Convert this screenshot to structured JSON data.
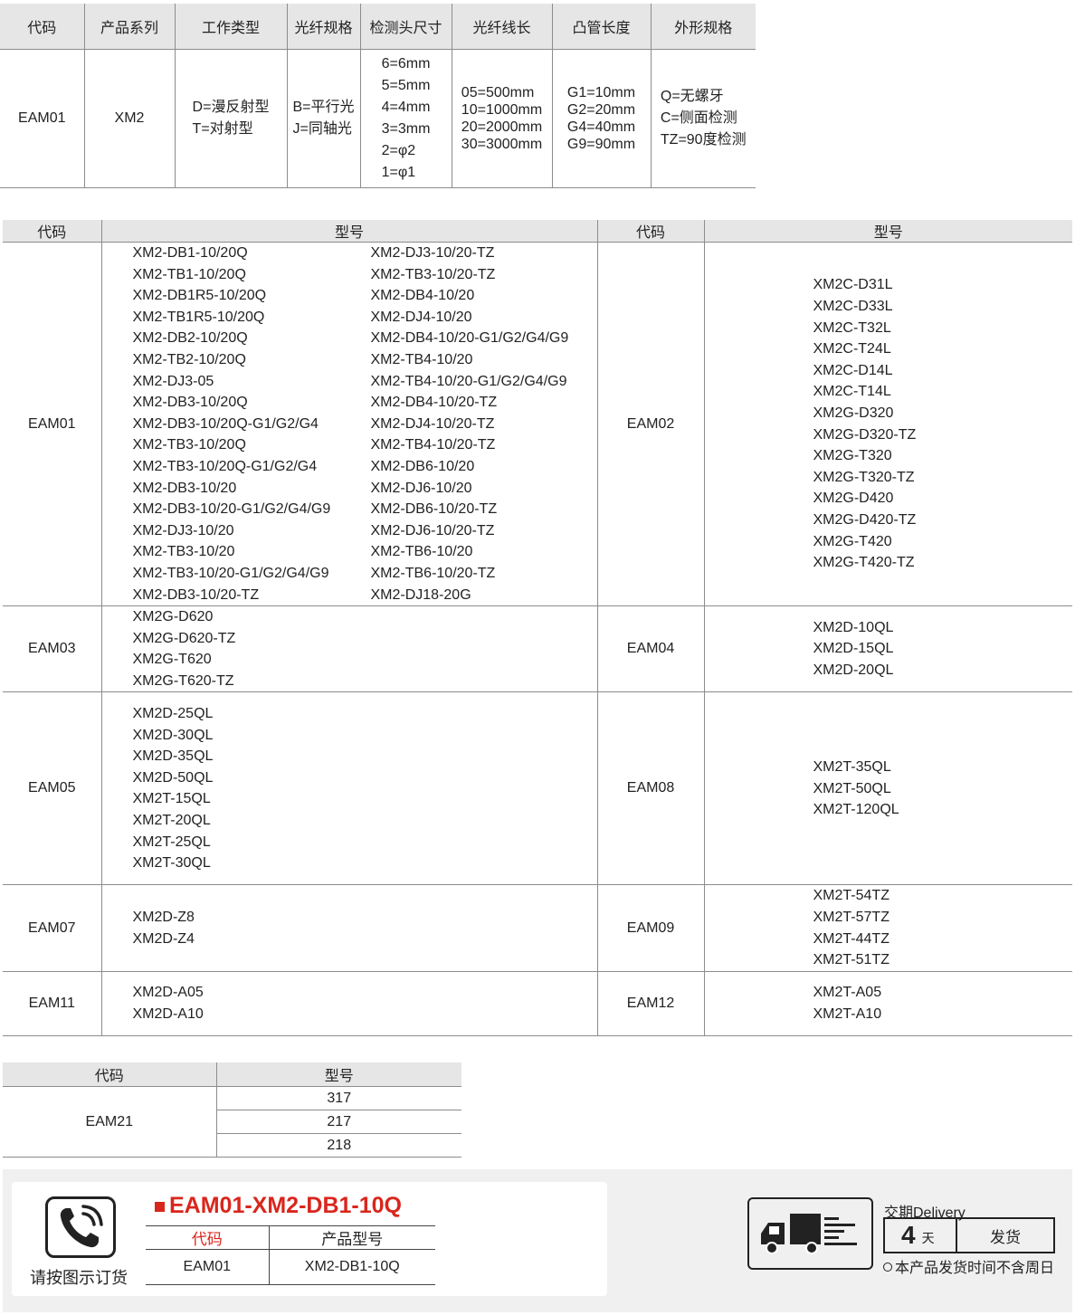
{
  "spec_table": {
    "headers": [
      "代码",
      "产品系列",
      "工作类型",
      "光纤规格",
      "检测头尺寸",
      "光纤线长",
      "凸管长度",
      "外形规格"
    ],
    "code": "EAM01",
    "series": "XM2",
    "work_type": [
      "D=漫反射型",
      "T=对射型"
    ],
    "fiber_spec": [
      "B=平行光",
      "J=同轴光"
    ],
    "head_size": [
      "6=6mm",
      "5=5mm",
      "4=4mm",
      "3=3mm",
      "2=φ2",
      "1=φ1"
    ],
    "fiber_length": [
      "05=500mm",
      "10=1000mm",
      "20=2000mm",
      "30=3000mm"
    ],
    "tube_length": [
      "G1=10mm",
      "G2=20mm",
      "G4=40mm",
      "G9=90mm"
    ],
    "shape": [
      "Q=无螺牙",
      "C=侧面检测",
      "TZ=90度检测"
    ]
  },
  "model_table": {
    "headers": [
      "代码",
      "型号",
      "代码",
      "型号"
    ],
    "eam01": {
      "code": "EAM01",
      "col1": [
        "XM2-DB1-10/20Q",
        "XM2-TB1-10/20Q",
        "XM2-DB1R5-10/20Q",
        "XM2-TB1R5-10/20Q",
        "XM2-DB2-10/20Q",
        "XM2-TB2-10/20Q",
        "XM2-DJ3-05",
        "XM2-DB3-10/20Q",
        "XM2-DB3-10/20Q-G1/G2/G4",
        "XM2-TB3-10/20Q",
        "XM2-TB3-10/20Q-G1/G2/G4",
        "XM2-DB3-10/20",
        "XM2-DB3-10/20-G1/G2/G4/G9",
        "XM2-DJ3-10/20",
        "XM2-TB3-10/20",
        "XM2-TB3-10/20-G1/G2/G4/G9",
        "XM2-DB3-10/20-TZ"
      ],
      "col2": [
        "XM2-DJ3-10/20-TZ",
        "XM2-TB3-10/20-TZ",
        "XM2-DB4-10/20",
        "XM2-DJ4-10/20",
        "XM2-DB4-10/20-G1/G2/G4/G9",
        "XM2-TB4-10/20",
        "XM2-TB4-10/20-G1/G2/G4/G9",
        "XM2-DB4-10/20-TZ",
        "XM2-DJ4-10/20-TZ",
        "XM2-TB4-10/20-TZ",
        "XM2-DB6-10/20",
        "XM2-DJ6-10/20",
        "XM2-DB6-10/20-TZ",
        "XM2-DJ6-10/20-TZ",
        "XM2-TB6-10/20",
        "XM2-TB6-10/20-TZ",
        "XM2-DJ18-20G"
      ]
    },
    "eam02": {
      "code": "EAM02",
      "items": [
        "XM2C-D31L",
        "XM2C-D33L",
        "XM2C-T32L",
        "XM2C-T24L",
        "XM2C-D14L",
        "XM2C-T14L",
        "XM2G-D320",
        "XM2G-D320-TZ",
        "XM2G-T320",
        "XM2G-T320-TZ",
        "XM2G-D420",
        "XM2G-D420-TZ",
        "XM2G-T420",
        "XM2G-T420-TZ"
      ]
    },
    "eam03": {
      "code": "EAM03",
      "items": [
        "XM2G-D620",
        "XM2G-D620-TZ",
        "XM2G-T620",
        "XM2G-T620-TZ"
      ]
    },
    "eam04": {
      "code": "EAM04",
      "items": [
        "XM2D-10QL",
        "XM2D-15QL",
        "XM2D-20QL"
      ]
    },
    "eam05": {
      "code": "EAM05",
      "items": [
        "XM2D-25QL",
        "XM2D-30QL",
        "XM2D-35QL",
        "XM2D-50QL",
        "XM2T-15QL",
        "XM2T-20QL",
        "XM2T-25QL",
        "XM2T-30QL"
      ]
    },
    "eam08": {
      "code": "EAM08",
      "items": [
        "XM2T-35QL",
        "XM2T-50QL",
        "XM2T-120QL"
      ]
    },
    "eam07": {
      "code": "EAM07",
      "items": [
        "XM2D-Z8",
        "XM2D-Z4"
      ]
    },
    "eam09": {
      "code": "EAM09",
      "items": [
        "XM2T-54TZ",
        "XM2T-57TZ",
        "XM2T-44TZ",
        "XM2T-51TZ"
      ]
    },
    "eam11": {
      "code": "EAM11",
      "items": [
        "XM2D-A05",
        "XM2D-A10"
      ]
    },
    "eam12": {
      "code": "EAM12",
      "items": [
        "XM2T-A05",
        "XM2T-A10"
      ]
    }
  },
  "small_table": {
    "headers": [
      "代码",
      "型号"
    ],
    "code": "EAM21",
    "models": [
      "317",
      "217",
      "218"
    ]
  },
  "order_example": {
    "caption": "请按图示订货",
    "title": "EAM01-XM2-DB1-10Q",
    "headers": [
      "代码",
      "产品型号"
    ],
    "code": "EAM01",
    "model": "XM2-DB1-10Q",
    "icon": "phone-icon"
  },
  "delivery": {
    "label": "交期Delivery",
    "days": "4",
    "unit": "天",
    "action": "发货",
    "note": "本产品发货时间不含周日",
    "icon": "truck-icon"
  },
  "colors": {
    "accent_red": "#d9261c",
    "header_gray": "#e6e6e6",
    "panel_gray": "#f0f0f0"
  }
}
